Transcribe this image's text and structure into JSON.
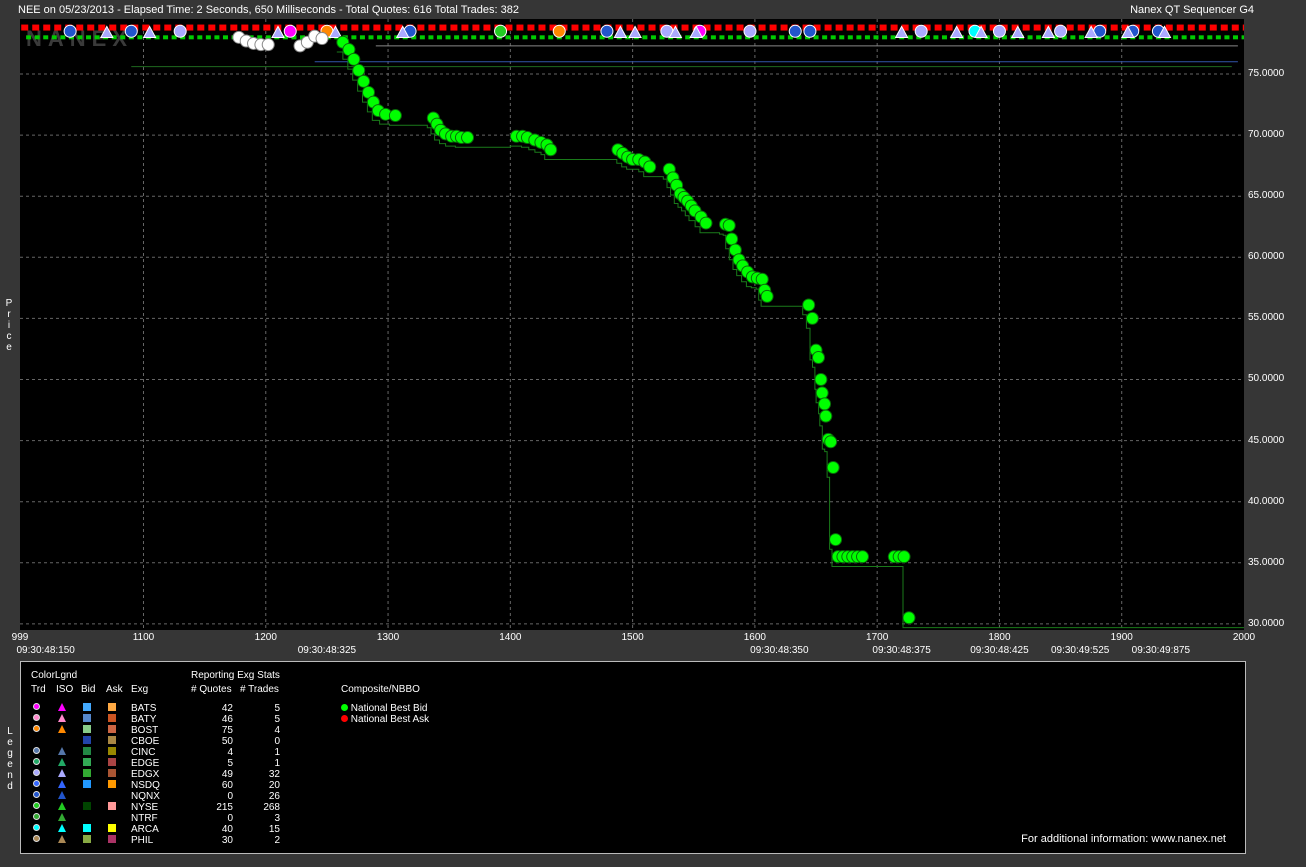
{
  "header": {
    "title_left": "NEE on 05/23/2013  -  Elapsed Time: 2 Seconds, 650 Milliseconds  -  Total Quotes: 616  Total Trades: 382",
    "title_right": "Nanex QT Sequencer G4"
  },
  "watermark": "NANEX",
  "chart_data": {
    "type": "scatter",
    "ylabel": "Price",
    "ylim": [
      29.5,
      79.5
    ],
    "xlim": [
      999,
      2000
    ],
    "y_ticks": [
      "75.0000",
      "70.0000",
      "65.0000",
      "60.0000",
      "55.0000",
      "50.0000",
      "45.0000",
      "40.0000",
      "35.0000",
      "30.0000"
    ],
    "y_tick_values": [
      75,
      70,
      65,
      60,
      55,
      50,
      45,
      40,
      35,
      30
    ],
    "x_ticks": [
      "999",
      "1100",
      "1200",
      "1300",
      "1400",
      "1500",
      "1600",
      "1700",
      "1800",
      "1900",
      "2000"
    ],
    "x_tick_values": [
      999,
      1100,
      1200,
      1300,
      1400,
      1500,
      1600,
      1700,
      1800,
      1900,
      2000
    ],
    "time_ticks": [
      {
        "x": 1020,
        "label": "09:30:48:150"
      },
      {
        "x": 1250,
        "label": "09:30:48:325"
      },
      {
        "x": 1620,
        "label": "09:30:48:350"
      },
      {
        "x": 1720,
        "label": "09:30:48:375"
      },
      {
        "x": 1800,
        "label": "09:30:48:425"
      },
      {
        "x": 1866,
        "label": "09:30:49:525"
      },
      {
        "x": 1932,
        "label": "09:30:49:875"
      }
    ],
    "grid": true,
    "series": [
      {
        "name": "National Best Bid",
        "color": "#00ff00",
        "points": [
          [
            1263,
            77.6
          ],
          [
            1268,
            77.0
          ],
          [
            1272,
            76.2
          ],
          [
            1276,
            75.3
          ],
          [
            1280,
            74.4
          ],
          [
            1284,
            73.5
          ],
          [
            1288,
            72.7
          ],
          [
            1292,
            72.0
          ],
          [
            1298,
            71.7
          ],
          [
            1306,
            71.6
          ],
          [
            1337,
            71.4
          ],
          [
            1340,
            70.9
          ],
          [
            1343,
            70.4
          ],
          [
            1347,
            70.1
          ],
          [
            1352,
            69.9
          ],
          [
            1356,
            69.9
          ],
          [
            1360,
            69.8
          ],
          [
            1365,
            69.8
          ],
          [
            1405,
            69.9
          ],
          [
            1410,
            69.9
          ],
          [
            1414,
            69.8
          ],
          [
            1420,
            69.6
          ],
          [
            1425,
            69.4
          ],
          [
            1430,
            69.2
          ],
          [
            1433,
            68.8
          ],
          [
            1488,
            68.8
          ],
          [
            1492,
            68.5
          ],
          [
            1496,
            68.2
          ],
          [
            1500,
            68.0
          ],
          [
            1505,
            68.0
          ],
          [
            1510,
            67.8
          ],
          [
            1514,
            67.4
          ],
          [
            1530,
            67.2
          ],
          [
            1533,
            66.5
          ],
          [
            1536,
            65.9
          ],
          [
            1539,
            65.2
          ],
          [
            1542,
            64.9
          ],
          [
            1545,
            64.6
          ],
          [
            1548,
            64.2
          ],
          [
            1551,
            63.8
          ],
          [
            1556,
            63.3
          ],
          [
            1560,
            62.8
          ],
          [
            1576,
            62.7
          ],
          [
            1579,
            62.6
          ],
          [
            1581,
            61.5
          ],
          [
            1584,
            60.6
          ],
          [
            1587,
            59.8
          ],
          [
            1590,
            59.3
          ],
          [
            1594,
            58.8
          ],
          [
            1598,
            58.4
          ],
          [
            1602,
            58.3
          ],
          [
            1606,
            58.2
          ],
          [
            1608,
            57.3
          ],
          [
            1610,
            56.8
          ],
          [
            1644,
            56.1
          ],
          [
            1647,
            55.0
          ],
          [
            1650,
            52.4
          ],
          [
            1652,
            51.8
          ],
          [
            1654,
            50.0
          ],
          [
            1655,
            48.9
          ],
          [
            1657,
            48.0
          ],
          [
            1658,
            47.0
          ],
          [
            1660,
            45.1
          ],
          [
            1662,
            44.9
          ],
          [
            1664,
            42.8
          ],
          [
            1666,
            36.9
          ],
          [
            1668,
            35.5
          ],
          [
            1672,
            35.5
          ],
          [
            1676,
            35.5
          ],
          [
            1680,
            35.5
          ],
          [
            1684,
            35.5
          ],
          [
            1688,
            35.5
          ],
          [
            1714,
            35.5
          ],
          [
            1718,
            35.5
          ],
          [
            1722,
            35.5
          ],
          [
            1726,
            30.5
          ]
        ]
      },
      {
        "name": "National Best Ask",
        "color": "#ff0000",
        "level": 78.8
      }
    ]
  },
  "legend": {
    "side_label": "Legend",
    "header_color": "ColorLgnd",
    "headers": [
      "Trd",
      "ISO",
      "Bid",
      "Ask",
      "Exg"
    ],
    "stats_header": "Reporting Exg Stats",
    "quotes_header": "# Quotes",
    "trades_header": "# Trades",
    "composite_header": "Composite/NBBO",
    "nbbo_bid": "National Best Bid",
    "nbbo_ask": "National Best Ask",
    "rows": [
      {
        "exg": "BATS",
        "quotes": "42",
        "trades": "5",
        "trd": "#ff00ff",
        "iso": "#ff00ff",
        "bid": "#44aaff",
        "ask": "#ffaa44"
      },
      {
        "exg": "BATY",
        "quotes": "46",
        "trades": "5",
        "trd": "#ff88cc",
        "iso": "#ff88cc",
        "bid": "#5588cc",
        "ask": "#cc5522"
      },
      {
        "exg": "BOST",
        "quotes": "75",
        "trades": "4",
        "trd": "#ff8800",
        "iso": "#ff8800",
        "bid": "#88cc88",
        "ask": "#cc6644"
      },
      {
        "exg": "CBOE",
        "quotes": "50",
        "trades": "0",
        "trd": "",
        "iso": "",
        "bid": "#2244aa",
        "ask": "#aa8844"
      },
      {
        "exg": "CINC",
        "quotes": "4",
        "trades": "1",
        "trd": "#5577aa",
        "iso": "#5577aa",
        "bid": "#228844",
        "ask": "#998800"
      },
      {
        "exg": "EDGE",
        "quotes": "5",
        "trades": "1",
        "trd": "#22aa66",
        "iso": "#22aa66",
        "bid": "#33aa55",
        "ask": "#aa4444"
      },
      {
        "exg": "EDGX",
        "quotes": "49",
        "trades": "32",
        "trd": "#aaaaff",
        "iso": "#aaaaff",
        "bid": "#33aa33",
        "ask": "#aa5533"
      },
      {
        "exg": "NSDQ",
        "quotes": "60",
        "trades": "20",
        "trd": "#3366ff",
        "iso": "#3366ff",
        "bid": "#2299ff",
        "ask": "#ff9900"
      },
      {
        "exg": "NQNX",
        "quotes": "0",
        "trades": "26",
        "trd": "#2255cc",
        "iso": "#2255cc",
        "bid": "",
        "ask": ""
      },
      {
        "exg": "NYSE",
        "quotes": "215",
        "trades": "268",
        "trd": "#22cc22",
        "iso": "#22cc22",
        "bid": "#004400",
        "ask": "#ff9999"
      },
      {
        "exg": "NTRF",
        "quotes": "0",
        "trades": "3",
        "trd": "#33aa33",
        "iso": "#33aa33",
        "bid": "",
        "ask": ""
      },
      {
        "exg": "ARCA",
        "quotes": "40",
        "trades": "15",
        "trd": "#00ffff",
        "iso": "#00ffff",
        "bid": "#00ffff",
        "ask": "#ffff00"
      },
      {
        "exg": "PHIL",
        "quotes": "30",
        "trades": "2",
        "trd": "#aa8855",
        "iso": "#aa8855",
        "bid": "#88aa44",
        "ask": "#aa3366"
      }
    ]
  },
  "footer": {
    "info": "For additional information: www.nanex.net"
  }
}
